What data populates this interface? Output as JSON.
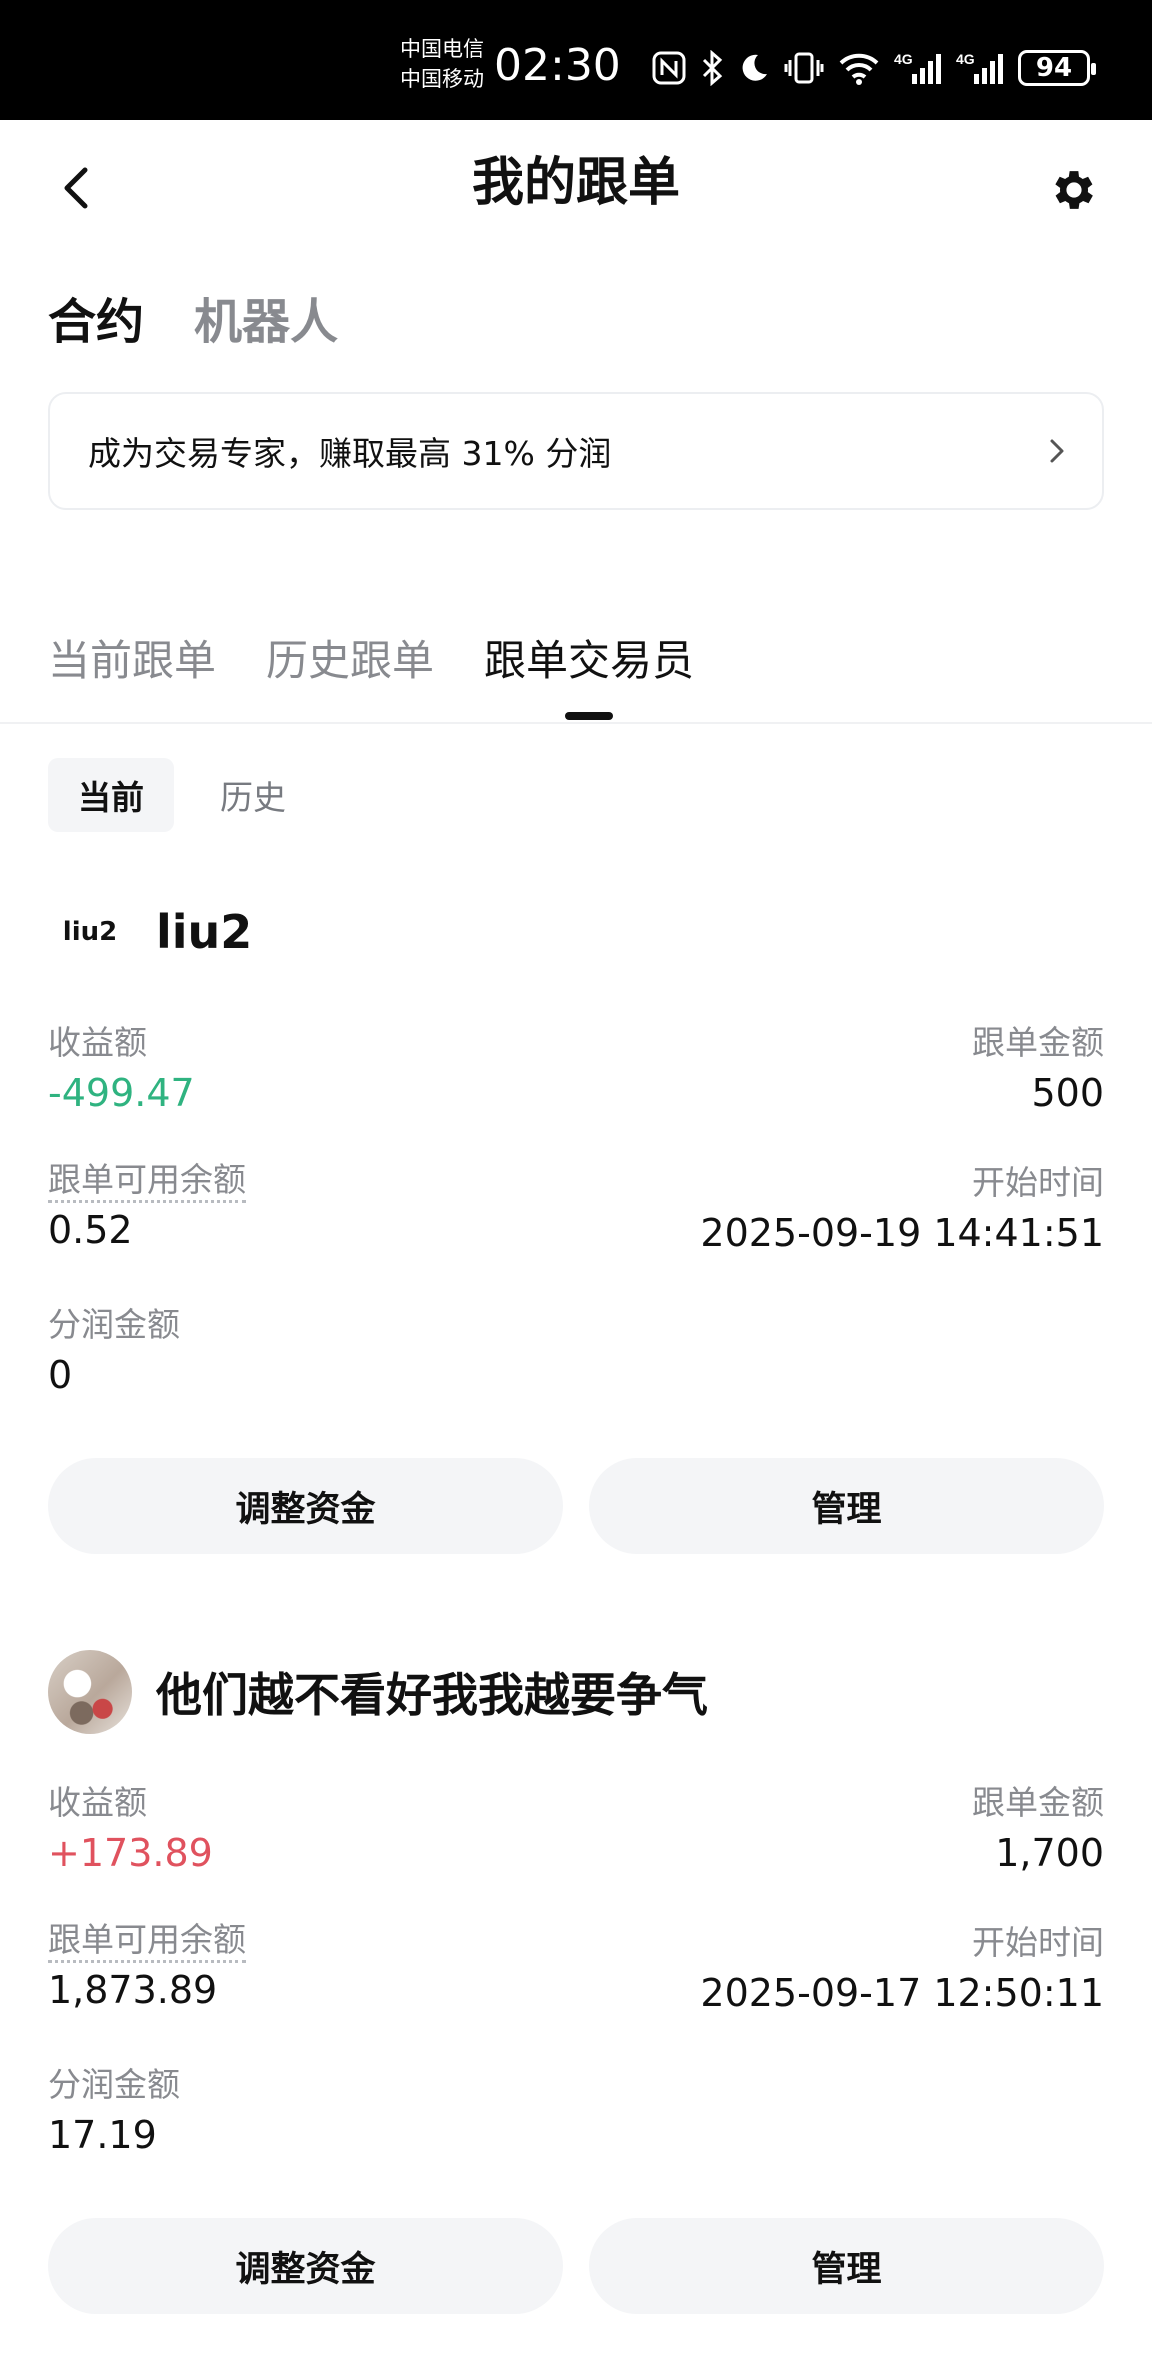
{
  "status_bar": {
    "carrier1": "中国电信",
    "carrier2": "中国移动",
    "time": "02:30",
    "battery": "94",
    "net1": "4G",
    "net2": "4G"
  },
  "header": {
    "title": "我的跟单"
  },
  "top_tabs": [
    {
      "label": "合约"
    },
    {
      "label": "机器人"
    }
  ],
  "promo": {
    "text": "成为交易专家，赚取最高 31% 分润"
  },
  "sub_tabs": [
    {
      "label": "当前跟单"
    },
    {
      "label": "历史跟单"
    },
    {
      "label": "跟单交易员"
    }
  ],
  "filters": [
    {
      "label": "当前"
    },
    {
      "label": "历史"
    }
  ],
  "labels": {
    "profit": "收益额",
    "follow_amount": "跟单金额",
    "available": "跟单可用余额",
    "start_time": "开始时间",
    "share": "分润金额",
    "adjust": "调整资金",
    "manage": "管理"
  },
  "cards": [
    {
      "avatar_text": "liu2",
      "name": "liu2",
      "profit": "-499.47",
      "follow_amount": "500",
      "available": "0.52",
      "start_time": "2025-09-19 14:41:51",
      "share": "0"
    },
    {
      "name": "他们越不看好我我越要争气",
      "profit": "+173.89",
      "follow_amount": "1,700",
      "available": "1,873.89",
      "start_time": "2025-09-17 12:50:11",
      "share": "17.19"
    }
  ],
  "colors": {
    "loss": "#2fb380",
    "gain": "#e0525e",
    "chip_bg": "#f4f5f7"
  }
}
